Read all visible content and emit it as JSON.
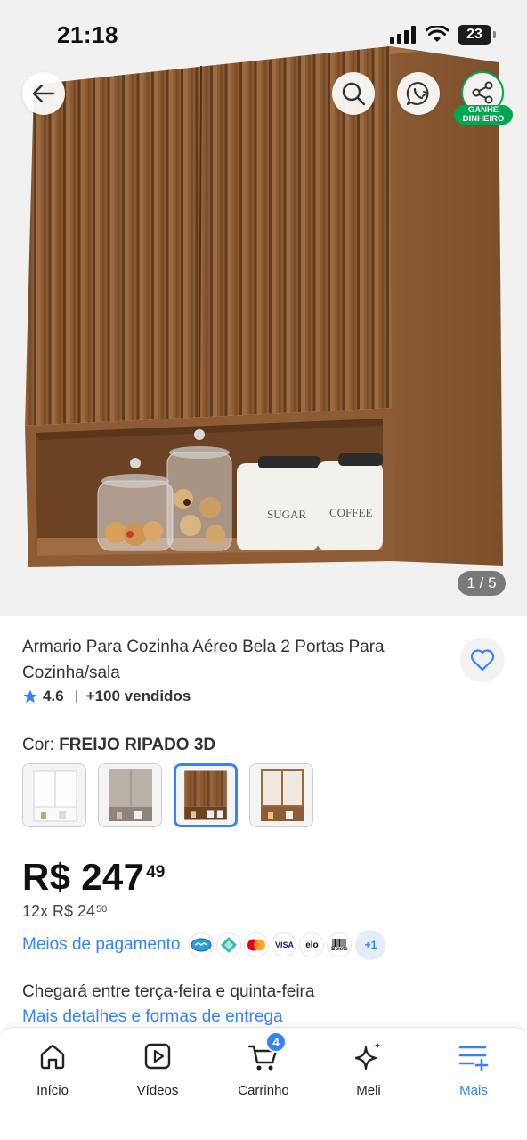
{
  "status_bar": {
    "time": "21:18",
    "battery": "23"
  },
  "hero": {
    "image_counter": "1 / 5",
    "earn_badge": [
      "GANHE",
      "DINHEIRO"
    ],
    "jar_labels": [
      "SUGAR",
      "COFFEE"
    ]
  },
  "product": {
    "title": "Armario Para Cozinha Aéreo Bela 2 Portas Para Cozinha/sala",
    "rating": "4.6",
    "sold": "+100 vendidos",
    "color_label": "Cor:",
    "color_value": "FREIJO RIPADO 3D",
    "variants": [
      {
        "name": "branco",
        "color": "#f4f4f4"
      },
      {
        "name": "cinza",
        "color": "#b9b0a6"
      },
      {
        "name": "freijo-ripado",
        "color": "#8b5a32",
        "selected": true
      },
      {
        "name": "off-white-freijo",
        "color": "#efe9df"
      }
    ],
    "price_main": "R$ 247",
    "price_cents": "49",
    "installment_main": "12x R$ 24",
    "installment_cents": "50",
    "payment_link": "Meios de pagamento",
    "payment_icons": [
      "mercado-pago-icon",
      "pix-icon",
      "mastercard-icon",
      "visa-icon",
      "elo-icon",
      "boleto-icon"
    ],
    "payment_labels": {
      "visa": "VISA",
      "elo": "elo",
      "boleto": "Boleto"
    },
    "payment_more": "+1",
    "delivery_text": "Chegará entre terça-feira e quinta-feira",
    "delivery_link": "Mais detalhes e formas de entrega"
  },
  "tabbar": {
    "items": [
      {
        "label": "Início",
        "icon": "home-icon"
      },
      {
        "label": "Vídeos",
        "icon": "video-icon"
      },
      {
        "label": "Carrinho",
        "icon": "cart-icon",
        "badge": "4"
      },
      {
        "label": "Meli",
        "icon": "sparkle-icon"
      },
      {
        "label": "Mais",
        "icon": "menu-plus-icon",
        "active": true
      }
    ]
  },
  "colors": {
    "accent": "#3483fa",
    "green": "#00a650",
    "wood": "#8b5a32"
  }
}
